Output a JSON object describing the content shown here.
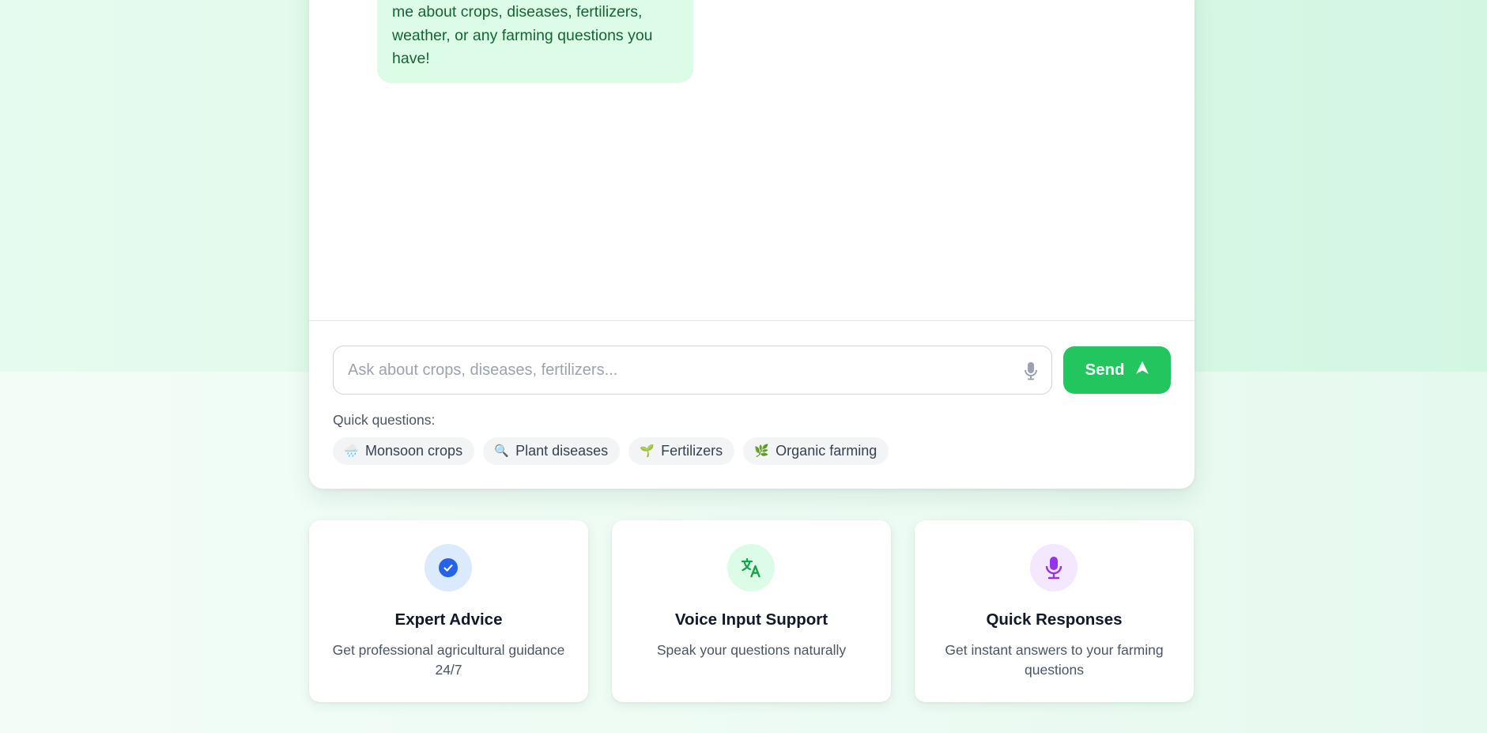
{
  "chat": {
    "bot_message_tail": "me about crops, diseases, fertilizers, weather, or any farming questions you have!",
    "input_placeholder": "Ask about crops, diseases, fertilizers...",
    "send_label": "Send",
    "quick_questions_label": "Quick questions:",
    "quick_questions": [
      {
        "emoji": "🌧️",
        "label": "Monsoon crops"
      },
      {
        "emoji": "🔍",
        "label": "Plant diseases"
      },
      {
        "emoji": "🌱",
        "label": "Fertilizers"
      },
      {
        "emoji": "🌿",
        "label": "Organic farming"
      }
    ]
  },
  "features": [
    {
      "icon": "shield-check-icon",
      "title": "Expert Advice",
      "description": "Get professional agricultural guidance 24/7",
      "icon_bg": "#dbeafe",
      "icon_color": "#2563eb"
    },
    {
      "icon": "translate-icon",
      "title": "Voice Input Support",
      "description": "Speak your questions naturally",
      "icon_bg": "#dcfce7",
      "icon_color": "#16a34a"
    },
    {
      "icon": "microphone-icon",
      "title": "Quick Responses",
      "description": "Get instant answers to your farming questions",
      "icon_bg": "#f3e8ff",
      "icon_color": "#9333ea"
    }
  ],
  "colors": {
    "accent": "#22c55e",
    "bubble_bg": "#dcfce7",
    "bubble_text": "#166534"
  }
}
